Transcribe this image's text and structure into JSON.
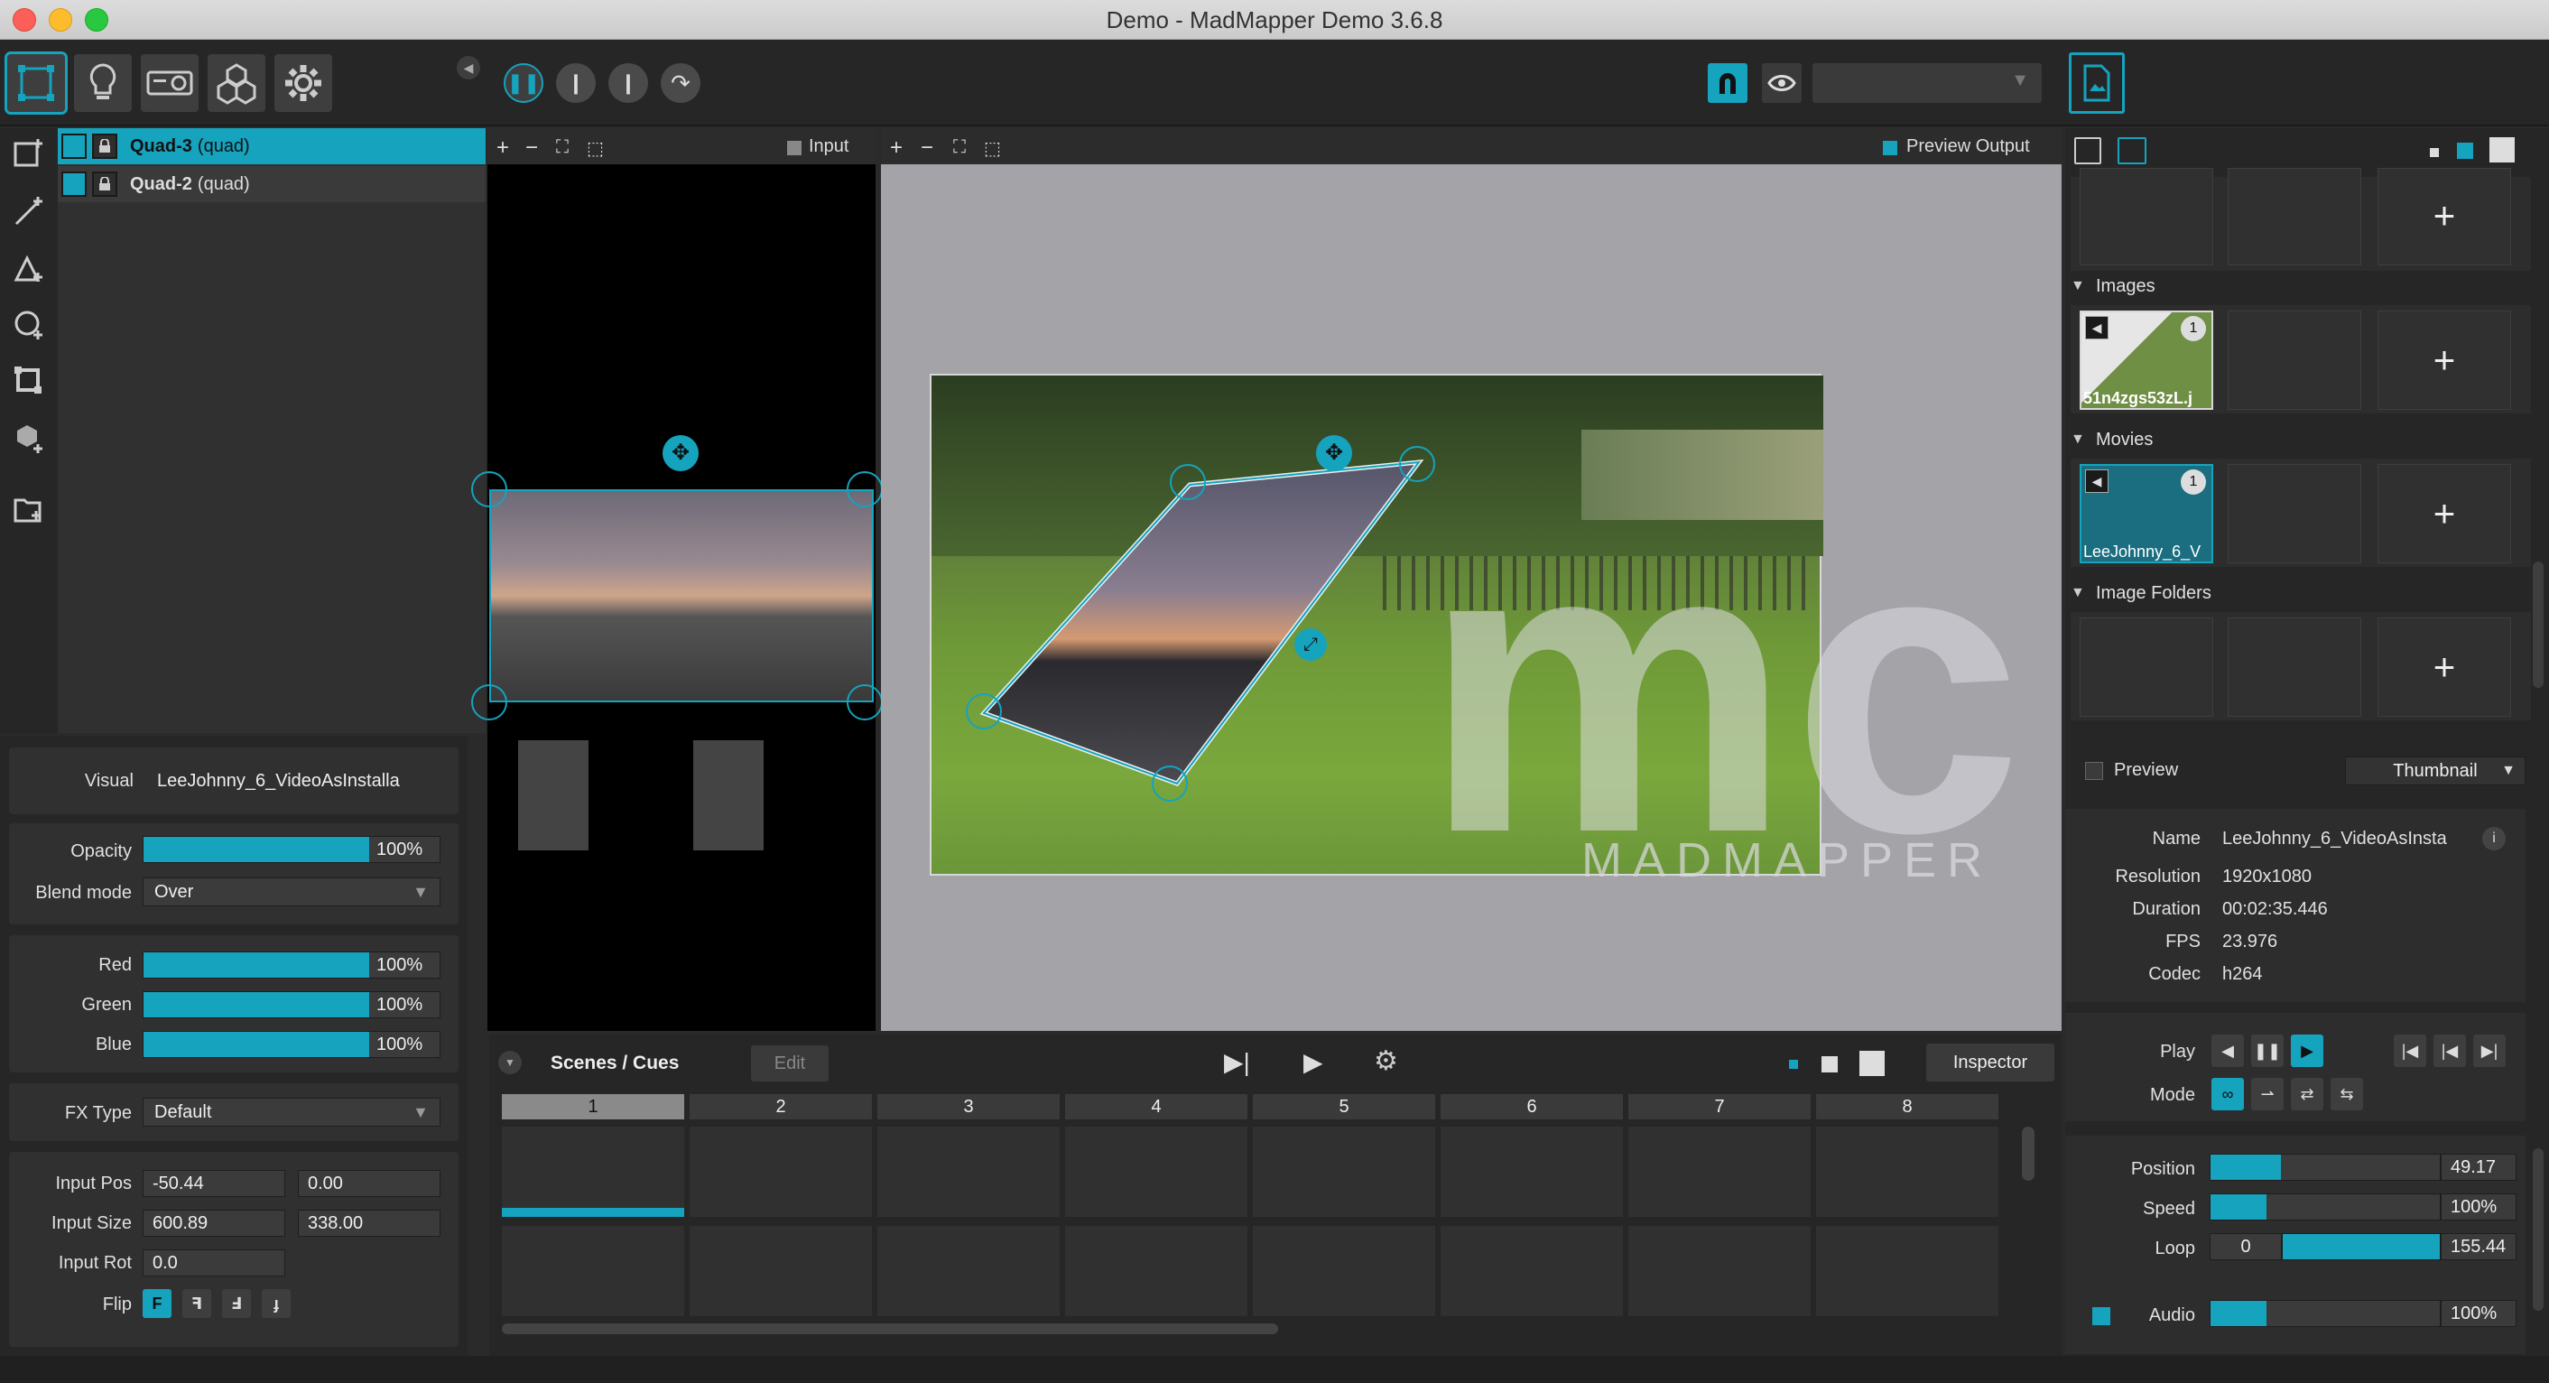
{
  "window": {
    "title": "Demo - MadMapper Demo 3.6.8"
  },
  "colors": {
    "accent": "#15a3be",
    "panel": "#303030",
    "background": "#262626"
  },
  "toolbar": {
    "icons": [
      "surfaces-icon",
      "lightbulb-icon",
      "projector-icon",
      "cubes-icon",
      "settings-gear-icon"
    ],
    "transport": [
      "pause-icon",
      "step-icon",
      "step-icon",
      "loop-arrow-icon"
    ]
  },
  "layers": [
    {
      "name": "Quad-3",
      "type": "(quad)"
    },
    {
      "name": "Quad-2",
      "type": "(quad)"
    }
  ],
  "input_panel": {
    "label": "Input"
  },
  "output_panel": {
    "label": "Preview Output",
    "watermark": "MADMAPPER"
  },
  "properties": {
    "visual_label": "Visual",
    "visual_value": "LeeJohnny_6_VideoAsInstalla",
    "opacity_label": "Opacity",
    "opacity_value": "100%",
    "opacity_level": 1.0,
    "blend_label": "Blend mode",
    "blend_value": "Over",
    "red_label": "Red",
    "red_value": "100%",
    "green_label": "Green",
    "green_value": "100%",
    "blue_label": "Blue",
    "blue_value": "100%",
    "fx_label": "FX Type",
    "fx_value": "Default",
    "input_pos_label": "Input Pos",
    "input_pos_x": "-50.44",
    "input_pos_y": "0.00",
    "input_size_label": "Input Size",
    "input_size_w": "600.89",
    "input_size_h": "338.00",
    "input_rot_label": "Input Rot",
    "input_rot_value": "0.0",
    "flip_label": "Flip",
    "flip_options": [
      "F",
      "ꟻ",
      "Ⅎ",
      "ɟ"
    ]
  },
  "scenes": {
    "title": "Scenes / Cues",
    "edit_label": "Edit",
    "inspector_label": "Inspector",
    "columns": [
      "1",
      "2",
      "3",
      "4",
      "5",
      "6",
      "7",
      "8"
    ]
  },
  "media": {
    "images_title": "Images",
    "image_name": "51n4zgs53zL.j",
    "image_badge": "1",
    "movies_title": "Movies",
    "movie_name": "LeeJohnny_6_V",
    "movie_badge": "1",
    "folders_title": "Image Folders",
    "preview_label": "Preview",
    "view_mode": "Thumbnail"
  },
  "info": {
    "name_label": "Name",
    "name_value": "LeeJohnny_6_VideoAsInsta",
    "resolution_label": "Resolution",
    "resolution_value": "1920x1080",
    "duration_label": "Duration",
    "duration_value": "00:02:35.446",
    "fps_label": "FPS",
    "fps_value": "23.976",
    "codec_label": "Codec",
    "codec_value": "h264"
  },
  "playback": {
    "play_label": "Play",
    "mode_label": "Mode",
    "position_label": "Position",
    "position_value": "49.17",
    "position_level": 0.3,
    "speed_label": "Speed",
    "speed_value": "100%",
    "speed_level": 0.25,
    "loop_label": "Loop",
    "loop_start": "0",
    "loop_end": "155.44",
    "audio_label": "Audio",
    "audio_value": "100%",
    "audio_level": 0.25
  }
}
